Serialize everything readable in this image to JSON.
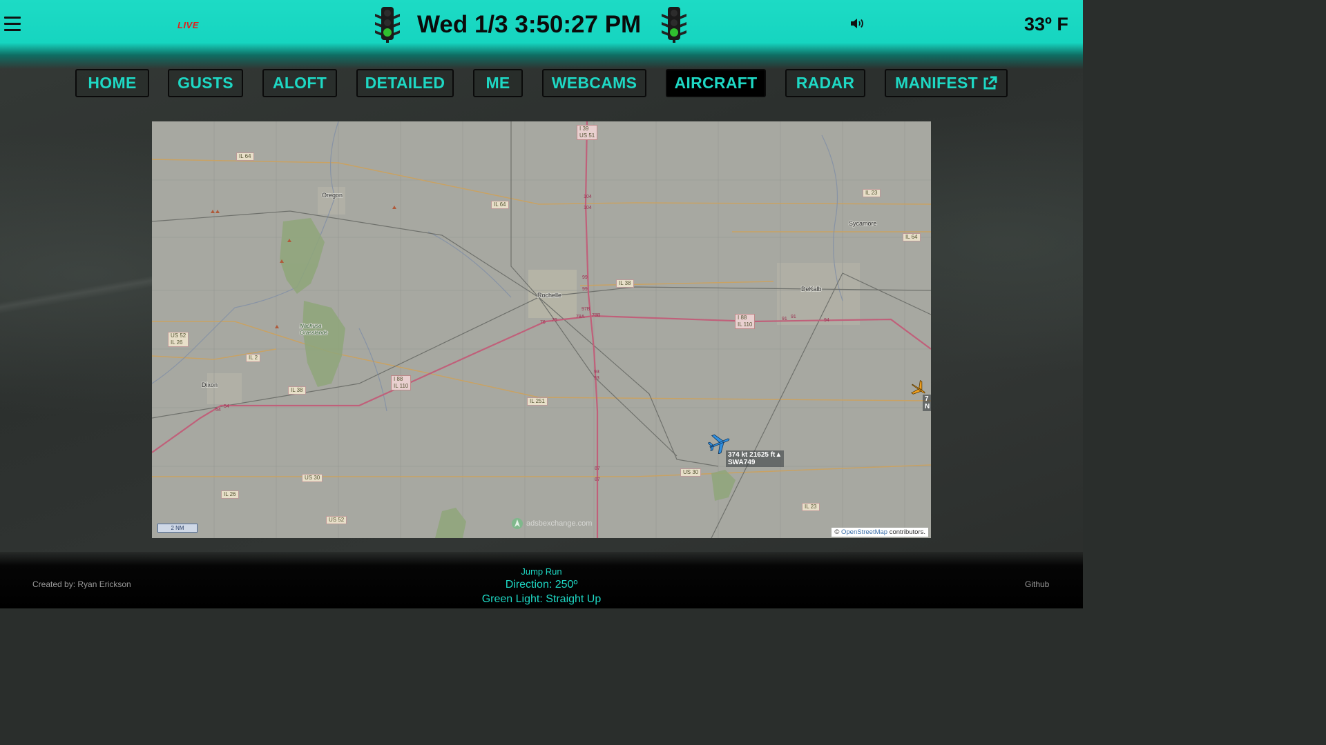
{
  "header": {
    "live_badge": "LIVE",
    "datetime": "Wed 1/3 3:50:27 PM",
    "temperature": "33º F",
    "icons": [
      "menu-icon",
      "traffic-light-icon",
      "speaker-icon"
    ]
  },
  "nav": {
    "items": [
      {
        "label": "HOME"
      },
      {
        "label": "GUSTS"
      },
      {
        "label": "ALOFT"
      },
      {
        "label": "DETAILED"
      },
      {
        "label": "ME"
      },
      {
        "label": "WEBCAMS"
      },
      {
        "label": "AIRCRAFT"
      },
      {
        "label": "RADAR"
      },
      {
        "label": "MANIFEST"
      }
    ],
    "active": "AIRCRAFT"
  },
  "map": {
    "places": {
      "oregon": "Oregon",
      "sycamore": "Sycamore",
      "dekalb": "DeKalb",
      "rochelle": "Rochelle",
      "dixon": "Dixon",
      "nachusa": "Nachusa\nGrasslands"
    },
    "shields": {
      "i39": "I 39\nUS 51",
      "il64_a": "IL 64",
      "il64_b": "IL 64",
      "il64_c": "IL 64",
      "il23_a": "IL 23",
      "il23_b": "IL 23",
      "il38_a": "IL 38",
      "il38_b": "IL 38",
      "i88_a": "I 88\nIL 110",
      "i88_b": "I 88\nIL 110",
      "us52_a": "US 52\nIL 26",
      "us52_b": "US 52",
      "il2": "IL 2",
      "il251": "IL 251",
      "us30_a": "US 30",
      "us30_b": "US 30",
      "il26": "IL 26"
    },
    "exit_labels": [
      "104",
      "104",
      "99",
      "99",
      "97B",
      "78A",
      "78B",
      "76",
      "76",
      "93",
      "93",
      "91",
      "91",
      "94",
      "87",
      "87",
      "54",
      "54"
    ],
    "scale": "2 NM",
    "watermark": "adsbexchange.com",
    "attribution_prefix": "©",
    "attribution_link": "OpenStreetMap",
    "attribution_suffix": "contributors.",
    "aircraft": [
      {
        "speed_alt": "374 kt  21625 ft▲",
        "callsign": "SWA749",
        "color": "#2f8fe0"
      },
      {
        "speed_alt": "7",
        "callsign": "N",
        "color": "#f0a020"
      }
    ]
  },
  "footer": {
    "credit": "Created by: Ryan Erickson",
    "jump_run_title": "Jump Run",
    "direction": "Direction: 250º",
    "green_light": "Green Light: Straight Up",
    "github": "Github"
  }
}
